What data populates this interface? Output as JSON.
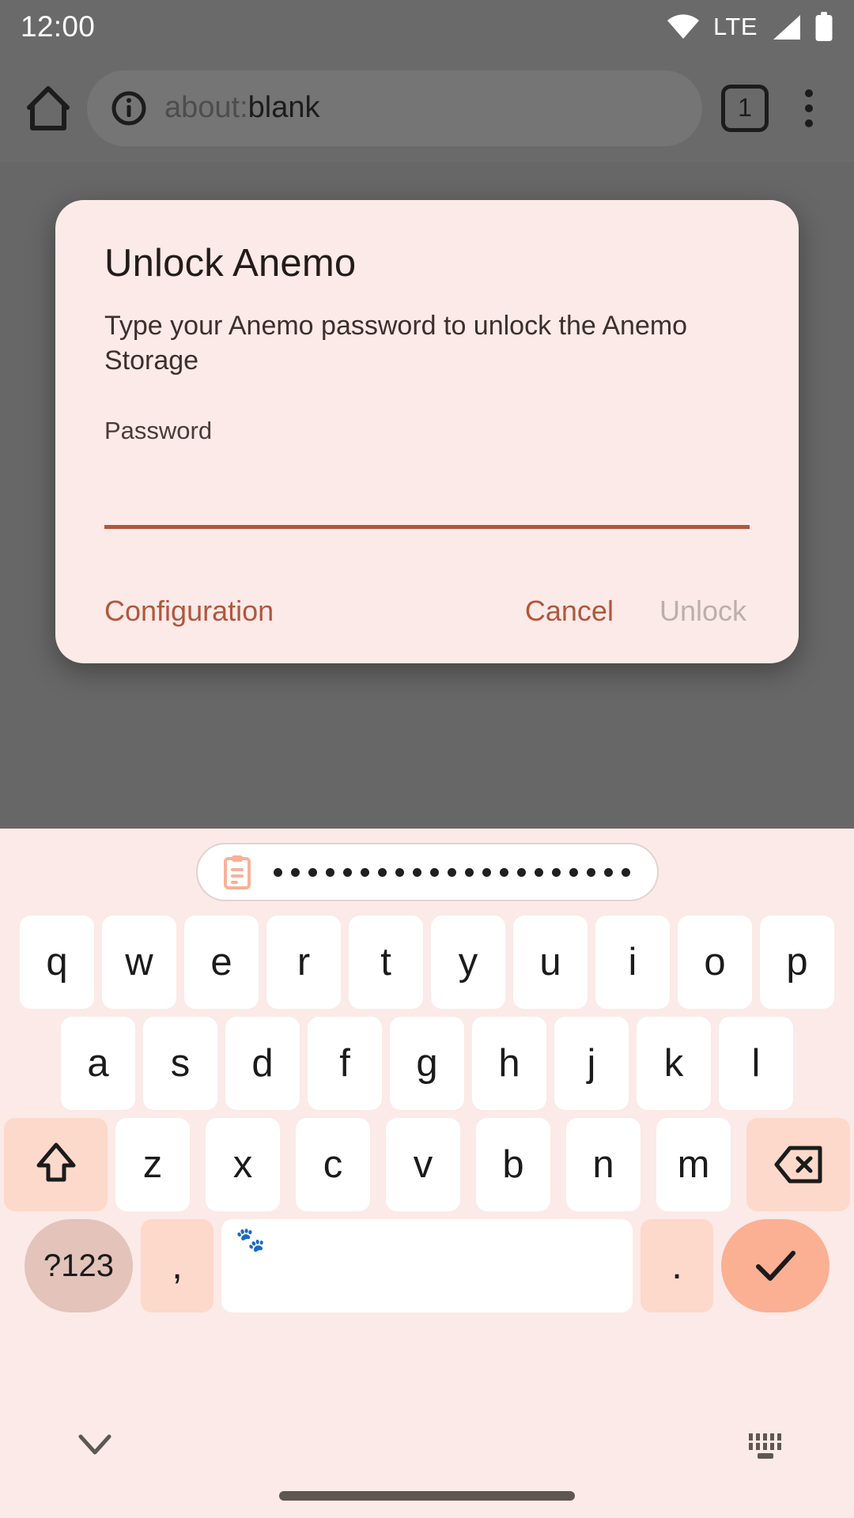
{
  "status_bar": {
    "time": "12:00",
    "network_label": "LTE",
    "icons": [
      "wifi-icon",
      "lte-label",
      "cellular-signal-icon",
      "battery-icon"
    ]
  },
  "browser": {
    "home_icon": "home-icon",
    "page_info_icon": "info-circle-icon",
    "url_scheme": "about:",
    "url_rest": "blank",
    "url_full": "about:blank",
    "tab_count": "1",
    "menu_icon": "overflow-menu-icon"
  },
  "dialog": {
    "title": "Unlock Anemo",
    "message": "Type your Anemo password to unlock the Anemo Storage",
    "password_label": "Password",
    "password_value": "",
    "password_placeholder": "",
    "buttons": {
      "configuration": "Configuration",
      "cancel": "Cancel",
      "unlock": "Unlock"
    },
    "unlock_enabled": false
  },
  "keyboard": {
    "suggestion": {
      "icon": "clipboard-icon",
      "masked_char": "●",
      "masked_count": 21
    },
    "rows": {
      "top": [
        "q",
        "w",
        "e",
        "r",
        "t",
        "y",
        "u",
        "i",
        "o",
        "p"
      ],
      "middle": [
        "a",
        "s",
        "d",
        "f",
        "g",
        "h",
        "j",
        "k",
        "l"
      ],
      "bottom": [
        "z",
        "x",
        "c",
        "v",
        "b",
        "n",
        "m"
      ]
    },
    "shift_icon": "shift-arrow-icon",
    "backspace_icon": "backspace-icon",
    "symbols_key": "?123",
    "comma_key": ",",
    "period_key": ".",
    "space_icon": "paw-print-icon",
    "enter_icon": "checkmark-icon"
  },
  "nav": {
    "hide_keyboard_icon": "chevron-down-icon",
    "switch_keyboard_icon": "keyboard-icon",
    "gesture_bar": "home-gesture-bar"
  },
  "colors": {
    "scrim": "#6a6a6a",
    "surface": "#fbeae7",
    "accent": "#b2563c",
    "enter_key": "#fbaf93",
    "mod_key": "#fcd9cb",
    "num_key": "#e3c3ba",
    "disabled_text": "#bbafac"
  }
}
